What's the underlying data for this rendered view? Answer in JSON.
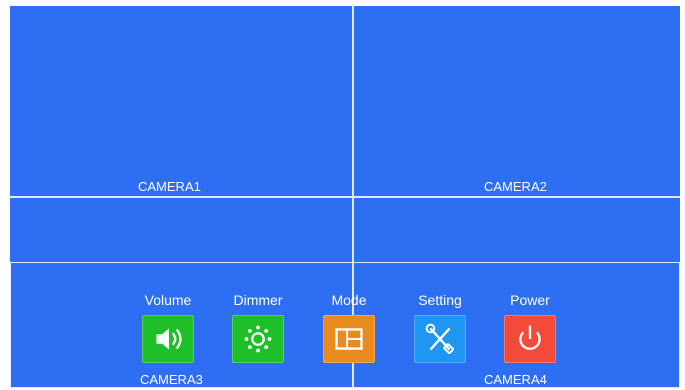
{
  "cameras": {
    "camera1": "CAMERA1",
    "camera2": "CAMERA2",
    "camera3": "CAMERA3",
    "camera4": "CAMERA4"
  },
  "menu": {
    "items": [
      {
        "label": "Volume",
        "icon": "speaker-icon",
        "color": "#1fbf2a"
      },
      {
        "label": "Dimmer",
        "icon": "sun-icon",
        "color": "#1fbf2a"
      },
      {
        "label": "Mode",
        "icon": "grid-icon",
        "color": "#e98b1f"
      },
      {
        "label": "Setting",
        "icon": "tools-icon",
        "color": "#1f96f2"
      },
      {
        "label": "Power",
        "icon": "power-icon",
        "color": "#f24b3a"
      }
    ]
  },
  "colors": {
    "background": "#2e6ef2",
    "divider": "#dfe8ff",
    "text": "#ffffff"
  }
}
